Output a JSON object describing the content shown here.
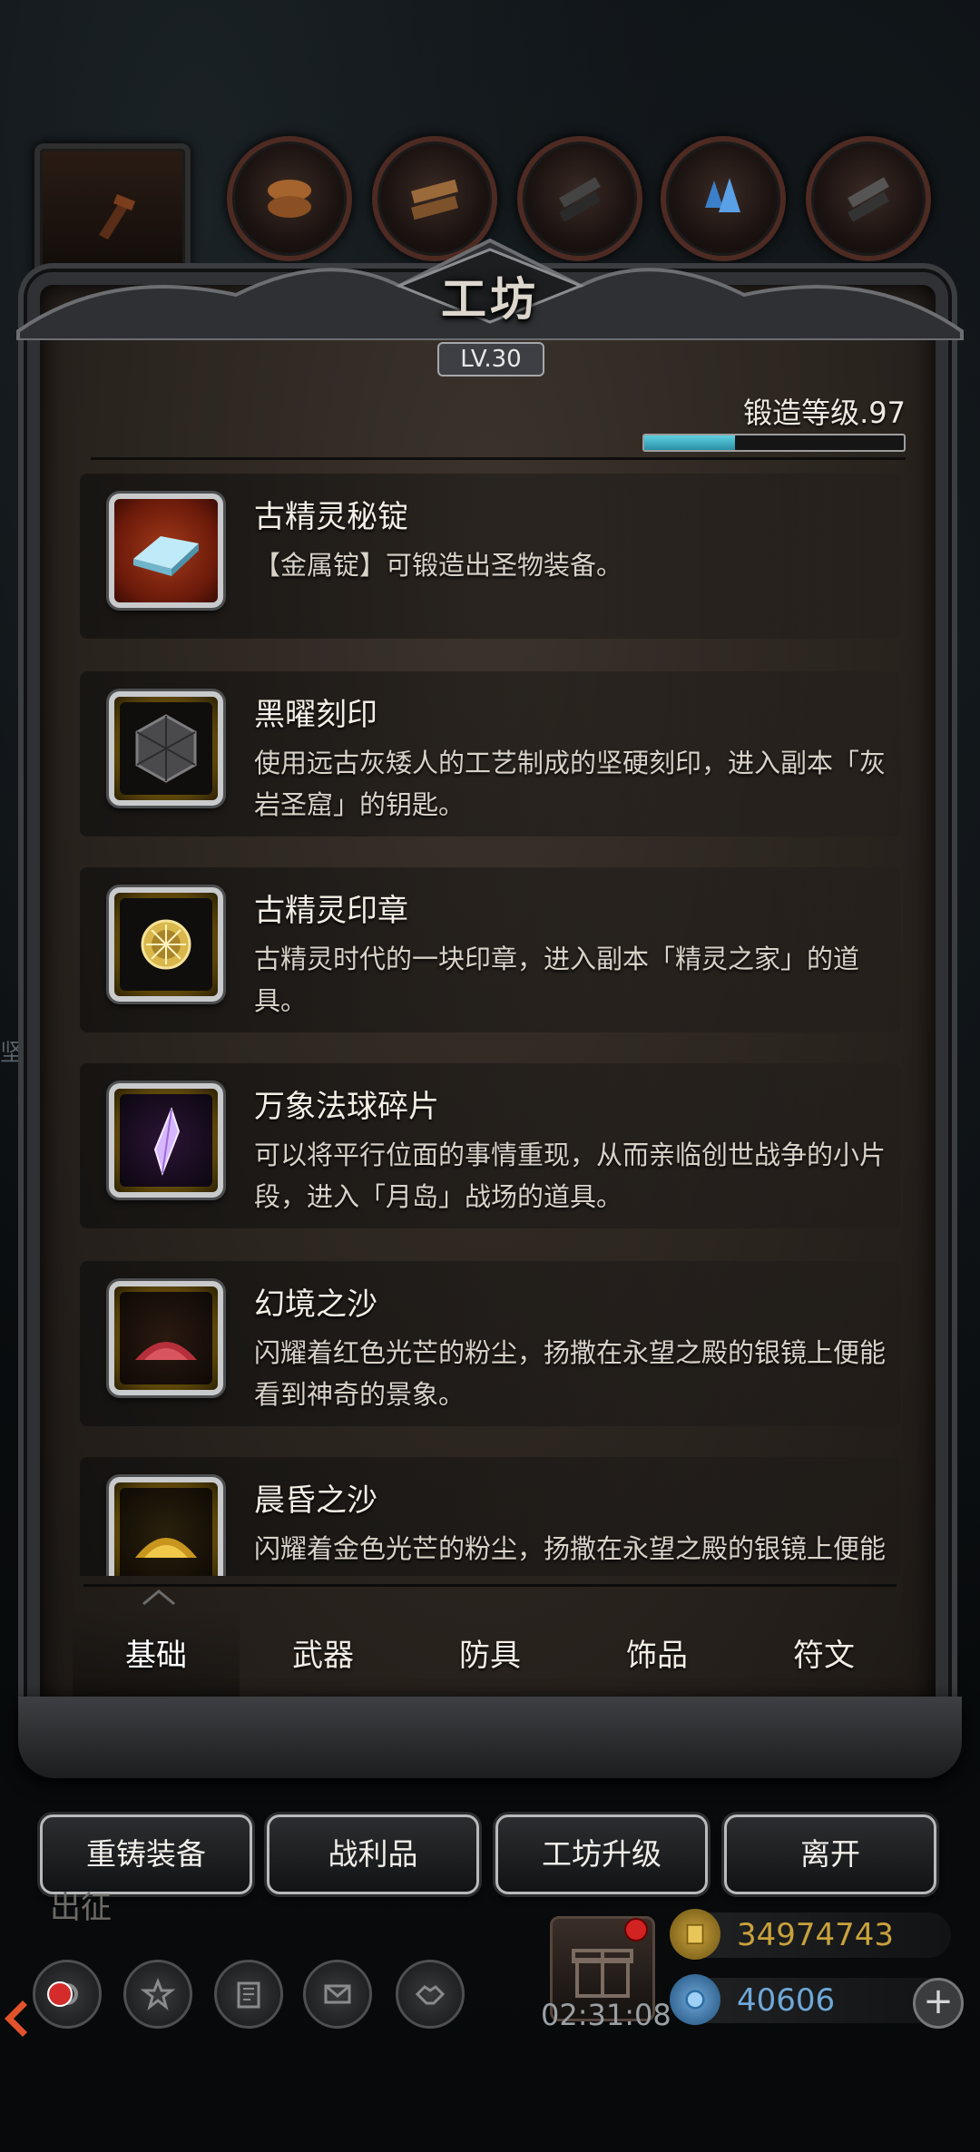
{
  "workshop": {
    "title": "工坊",
    "level": "LV.30",
    "forge_level_label": "锻造等级.97",
    "forge_progress": 0.35
  },
  "items": [
    {
      "name": "古精灵秘锭",
      "description": "【金属锭】可锻造出圣物装备。",
      "icon": "ingot-icon",
      "frame": "red"
    },
    {
      "name": "黑曜刻印",
      "description": "使用远古灰矮人的工艺制成的坚硬刻印，进入副本「灰岩圣窟」的钥匙。",
      "icon": "obsidian-seal-icon",
      "frame": "gold"
    },
    {
      "name": "古精灵印章",
      "description": "古精灵时代的一块印章，进入副本「精灵之家」的道具。",
      "icon": "elven-seal-icon",
      "frame": "gold"
    },
    {
      "name": "万象法球碎片",
      "description": "可以将平行位面的事情重现，从而亲临创世战争的小片段，进入「月岛」战场的道具。",
      "icon": "crystal-shard-icon",
      "frame": "gold"
    },
    {
      "name": "幻境之沙",
      "description": "闪耀着红色光芒的粉尘，扬撒在永望之殿的银镜上便能看到神奇的景象。",
      "icon": "red-sand-icon",
      "frame": "gold"
    },
    {
      "name": "晨昏之沙",
      "description": "闪耀着金色光芒的粉尘，扬撒在永望之殿的银镜上便能看到神奇的景象。",
      "icon": "gold-sand-icon",
      "frame": "gold"
    }
  ],
  "tabs": [
    "基础",
    "武器",
    "防具",
    "饰品",
    "符文"
  ],
  "active_tab": "基础",
  "actions": {
    "reforge": "重铸装备",
    "loot": "战利品",
    "upgrade": "工坊升级",
    "leave": "离开"
  },
  "hud": {
    "expedition_label": "出征",
    "timer": "02:31:08",
    "gold": "34974743",
    "gems": "40606",
    "plus": "+",
    "side_char": "坚"
  },
  "colors": {
    "gold_text": "#c9a23c",
    "gem_text": "#6fa8d8",
    "progress": "#4fc3d6"
  }
}
